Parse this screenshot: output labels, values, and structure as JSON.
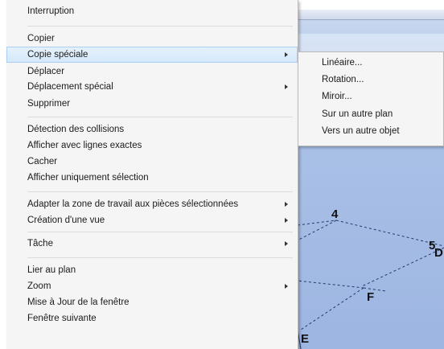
{
  "context_menu": {
    "items": [
      {
        "label": "Interruption"
      },
      {
        "label": "Copier"
      },
      {
        "label": "Copie spéciale"
      },
      {
        "label": "Déplacer"
      },
      {
        "label": "Déplacement spécial"
      },
      {
        "label": "Supprimer"
      },
      {
        "label": "Détection des collisions"
      },
      {
        "label": "Afficher avec lignes exactes"
      },
      {
        "label": "Cacher"
      },
      {
        "label": "Afficher uniquement sélection"
      },
      {
        "label": "Adapter la zone de travail aux pièces sélectionnées"
      },
      {
        "label": "Création d'une vue"
      },
      {
        "label": "Tâche"
      },
      {
        "label": "Lier au plan"
      },
      {
        "label": "Zoom"
      },
      {
        "label": "Mise à Jour de la fenêtre"
      },
      {
        "label": "Fenêtre suivante"
      }
    ],
    "highlighted_item": "Copie spéciale"
  },
  "submenu": {
    "items": [
      {
        "label": "Linéaire..."
      },
      {
        "label": "Rotation..."
      },
      {
        "label": "Miroir..."
      },
      {
        "label": "Sur un autre plan"
      },
      {
        "label": "Vers un autre objet"
      }
    ]
  },
  "viewport": {
    "point_labels": {
      "p4": "4",
      "p5": "5",
      "pD": "D",
      "pF": "F",
      "pE": "E"
    }
  },
  "colors": {
    "menu_bg": "#f5f5f5",
    "highlight_bg": "#d3e8fa",
    "viewport_bg": "#a9c0e6"
  }
}
